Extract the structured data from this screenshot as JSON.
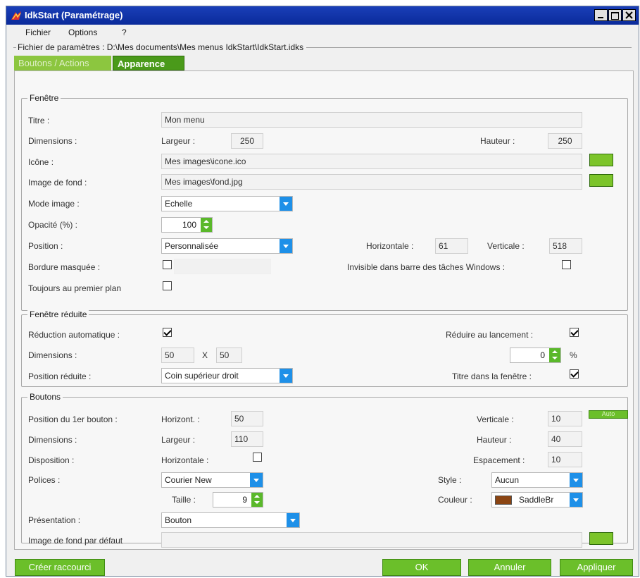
{
  "window": {
    "title": "IdkStart (Paramétrage)"
  },
  "menu": {
    "fichier": "Fichier",
    "options": "Options",
    "help": "?"
  },
  "file_info": "Fichier de paramètres : D:\\Mes documents\\Mes menus IdkStart\\IdkStart.idks",
  "tabs": {
    "boutons": "Boutons / Actions",
    "apparence": "Apparence"
  },
  "fenetre": {
    "group": "Fenêtre",
    "titre_label": "Titre :",
    "titre_value": "Mon menu",
    "dimensions_label": "Dimensions :",
    "largeur_label": "Largeur :",
    "largeur_value": "250",
    "hauteur_label": "Hauteur :",
    "hauteur_value": "250",
    "icone_label": "Icône :",
    "icone_value": "Mes images\\icone.ico",
    "image_fond_label": "Image de fond :",
    "image_fond_value": "Mes images\\fond.jpg",
    "mode_image_label": "Mode image :",
    "mode_image_value": "Echelle",
    "opacite_label": "Opacité (%) :",
    "opacite_value": "100",
    "position_label": "Position :",
    "position_value": "Personnalisée",
    "horizontale_label": "Horizontale :",
    "horizontale_value": "61",
    "verticale_label": "Verticale :",
    "verticale_value": "518",
    "bordure_label": "Bordure masquée :",
    "invisible_label": "Invisible dans barre des tâches Windows :",
    "toujours_label": "Toujours au premier plan",
    "bordure_checked": false,
    "invisible_checked": false,
    "toujours_checked": false
  },
  "reduite": {
    "group": "Fenêtre réduite",
    "reduction_label": "Réduction automatique :",
    "reduction_checked": true,
    "reduire_label": "Réduire au lancement :",
    "reduire_checked": true,
    "dimensions_label": "Dimensions :",
    "dim_w": "50",
    "x_label": "X",
    "dim_h": "50",
    "percent_value": "0",
    "percent_label": "%",
    "position_label": "Position réduite :",
    "position_value": "Coin supérieur droit",
    "titre_label": "Titre dans la fenêtre :",
    "titre_checked": true
  },
  "boutons": {
    "group": "Boutons",
    "position_label": "Position du 1er bouton :",
    "horizont_label": "Horizont. :",
    "horizont_value": "50",
    "verticale_label": "Verticale :",
    "verticale_value": "10",
    "auto_label": "Auto",
    "dimensions_label": "Dimensions :",
    "largeur_label": "Largeur :",
    "largeur_value": "110",
    "hauteur_label": "Hauteur :",
    "hauteur_value": "40",
    "disposition_label": "Disposition :",
    "horizontale_label": "Horizontale :",
    "horizontale_checked": false,
    "espacement_label": "Espacement :",
    "espacement_value": "10",
    "polices_label": "Polices :",
    "police_value": "Courier New",
    "style_label": "Style :",
    "style_value": "Aucun",
    "taille_label": "Taille :",
    "taille_value": "9",
    "couleur_label": "Couleur :",
    "couleur_value": "SaddleBr",
    "couleur_swatch": "#8b4513",
    "presentation_label": "Présentation :",
    "presentation_value": "Bouton",
    "image_defaut_label": "Image de fond par défaut",
    "image_defaut_value": ""
  },
  "footer": {
    "creer": "Créer raccourci",
    "ok": "OK",
    "annuler": "Annuler",
    "appliquer": "Appliquer"
  }
}
